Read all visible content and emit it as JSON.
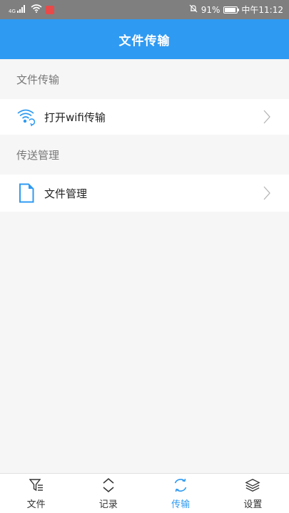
{
  "status_bar": {
    "network": "4G",
    "battery_percent": "91%",
    "battery_level": 0.91,
    "time": "中午11:12"
  },
  "header": {
    "title": "文件传输"
  },
  "sections": [
    {
      "label": "文件传输",
      "item_label": "打开wifi传输",
      "icon": "wifi-transfer-icon"
    },
    {
      "label": "传送管理",
      "item_label": "文件管理",
      "icon": "document-icon"
    }
  ],
  "tabs": [
    {
      "label": "文件",
      "icon": "filter-icon",
      "active": false
    },
    {
      "label": "记录",
      "icon": "expand-icon",
      "active": false
    },
    {
      "label": "传输",
      "icon": "sync-icon",
      "active": true
    },
    {
      "label": "设置",
      "icon": "layers-icon",
      "active": false
    }
  ],
  "colors": {
    "accent": "#2f9af2",
    "status_bar": "#7f7f7f",
    "background": "#f6f6f6"
  }
}
